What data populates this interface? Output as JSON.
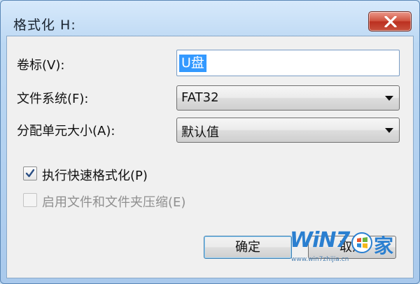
{
  "window": {
    "title": "格式化 H:"
  },
  "form": {
    "volume_label": {
      "label": "卷标(V):",
      "value": "U盘"
    },
    "file_system": {
      "label": "文件系统(F):",
      "selected": "FAT32"
    },
    "allocation_unit": {
      "label": "分配单元大小(A):",
      "selected": "默认值"
    },
    "quick_format": {
      "label": "执行快速格式化(P)",
      "checked": true,
      "enabled": true
    },
    "compression": {
      "label": "启用文件和文件夹压缩(E)",
      "checked": false,
      "enabled": false
    }
  },
  "buttons": {
    "ok": "确定",
    "cancel": "取消"
  },
  "watermark": {
    "brand": "WiN7",
    "brand_suffix": "家",
    "url": "www.win7zhijia.cn"
  },
  "colors": {
    "selection": "#3399ff",
    "close_button": "#c8513d",
    "frame": "#bcd8f3"
  }
}
